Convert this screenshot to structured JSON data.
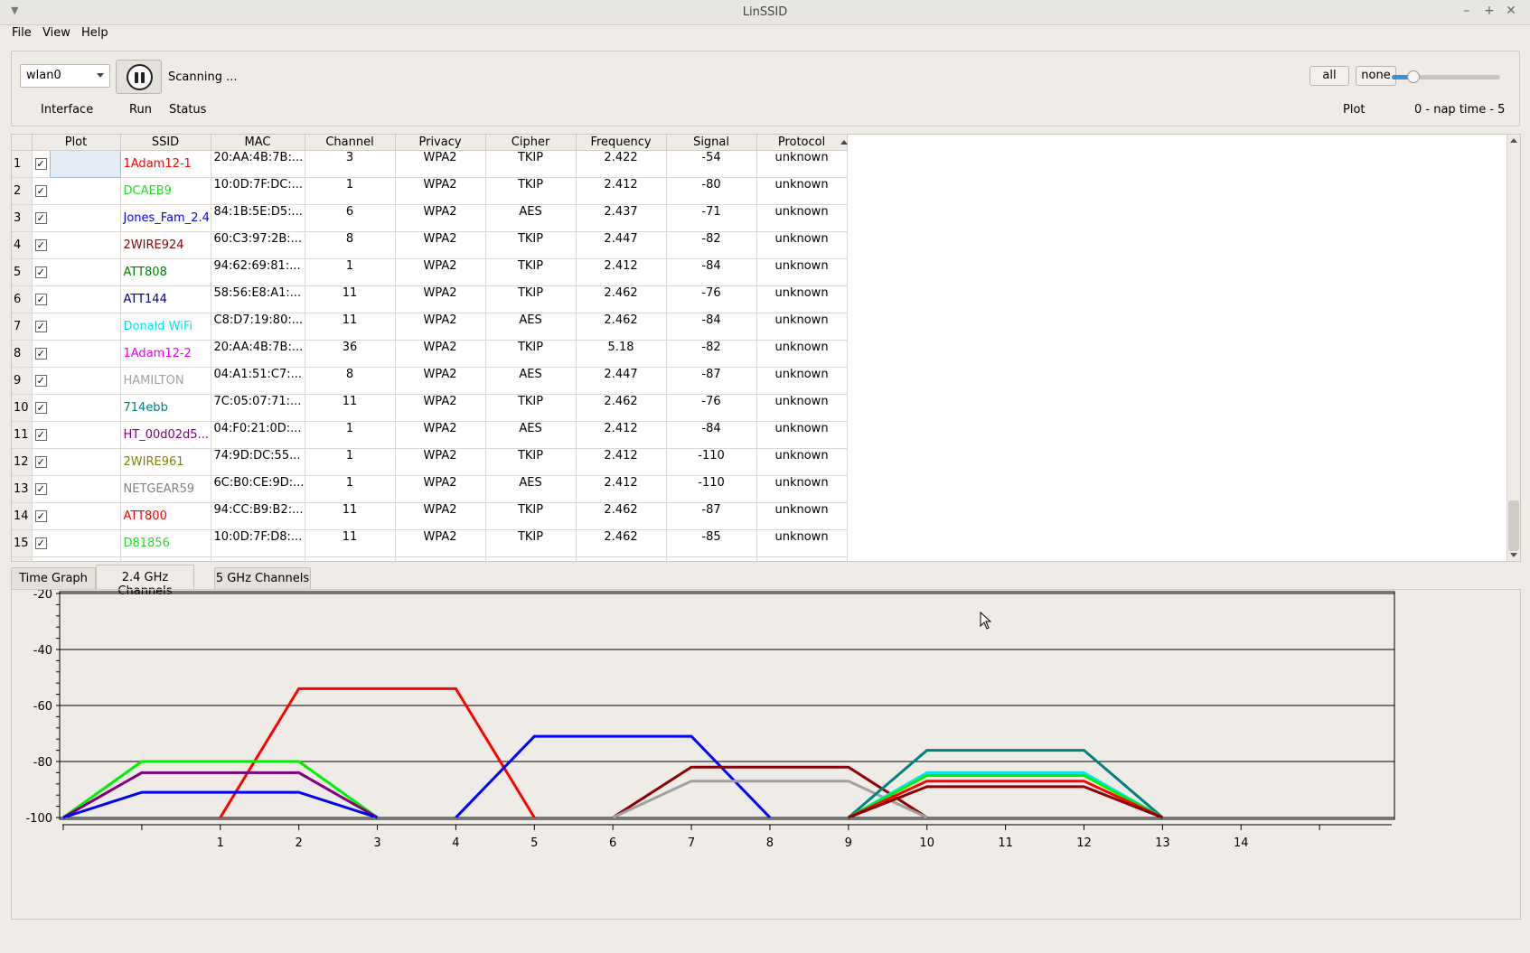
{
  "window": {
    "title": "LinSSID"
  },
  "menu": [
    "File",
    "View",
    "Help"
  ],
  "toolbar": {
    "interface_value": "wlan0",
    "status_text": "Scanning ...",
    "labels": {
      "interface": "Interface",
      "run": "Run",
      "status": "Status",
      "plot": "Plot",
      "naptime": "0 - nap time - 5"
    },
    "all_label": "all",
    "none_label": "none",
    "nap_time": 1
  },
  "table": {
    "columns": [
      "Plot",
      "SSID",
      "MAC",
      "Channel",
      "Privacy",
      "Cipher",
      "Frequency",
      "Signal",
      "Protocol"
    ],
    "rows": [
      {
        "n": "1",
        "ssid": "1Adam12-1",
        "color": "#ff0000",
        "mac": "20:AA:4B:7B:...",
        "channel": "3",
        "privacy": "WPA2",
        "cipher": "TKIP",
        "freq": "2.422",
        "signal": "-54",
        "protocol": "unknown"
      },
      {
        "n": "2",
        "ssid": "DCAEB9",
        "color": "#22dd22",
        "mac": "10:0D:7F:DC:...",
        "channel": "1",
        "privacy": "WPA2",
        "cipher": "TKIP",
        "freq": "2.412",
        "signal": "-80",
        "protocol": "unknown"
      },
      {
        "n": "3",
        "ssid": "Jones_Fam_2.4",
        "color": "#0000ff",
        "mac": "84:1B:5E:D5:...",
        "channel": "6",
        "privacy": "WPA2",
        "cipher": "AES",
        "freq": "2.437",
        "signal": "-71",
        "protocol": "unknown"
      },
      {
        "n": "4",
        "ssid": "2WIRE924",
        "color": "#8b0000",
        "mac": "60:C3:97:2B:...",
        "channel": "8",
        "privacy": "WPA2",
        "cipher": "TKIP",
        "freq": "2.447",
        "signal": "-82",
        "protocol": "unknown"
      },
      {
        "n": "5",
        "ssid": "ATT808",
        "color": "#008000",
        "mac": "94:62:69:81:...",
        "channel": "1",
        "privacy": "WPA2",
        "cipher": "TKIP",
        "freq": "2.412",
        "signal": "-84",
        "protocol": "unknown"
      },
      {
        "n": "6",
        "ssid": "ATT144",
        "color": "#000080",
        "mac": "58:56:E8:A1:...",
        "channel": "11",
        "privacy": "WPA2",
        "cipher": "TKIP",
        "freq": "2.462",
        "signal": "-76",
        "protocol": "unknown"
      },
      {
        "n": "7",
        "ssid": "Donald WiFi",
        "color": "#00e5ee",
        "mac": "C8:D7:19:80:...",
        "channel": "11",
        "privacy": "WPA2",
        "cipher": "AES",
        "freq": "2.462",
        "signal": "-84",
        "protocol": "unknown"
      },
      {
        "n": "8",
        "ssid": "1Adam12-2",
        "color": "#ee00ee",
        "mac": "20:AA:4B:7B:...",
        "channel": "36",
        "privacy": "WPA2",
        "cipher": "TKIP",
        "freq": "5.18",
        "signal": "-82",
        "protocol": "unknown"
      },
      {
        "n": "9",
        "ssid": "HAMILTON",
        "color": "#a0a0a0",
        "mac": "04:A1:51:C7:...",
        "channel": "8",
        "privacy": "WPA2",
        "cipher": "AES",
        "freq": "2.447",
        "signal": "-87",
        "protocol": "unknown"
      },
      {
        "n": "10",
        "ssid": "714ebb",
        "color": "#008080",
        "mac": "7C:05:07:71:...",
        "channel": "11",
        "privacy": "WPA2",
        "cipher": "TKIP",
        "freq": "2.462",
        "signal": "-76",
        "protocol": "unknown"
      },
      {
        "n": "11",
        "ssid": "HT_00d02d5...",
        "color": "#800080",
        "mac": "04:F0:21:0D:...",
        "channel": "1",
        "privacy": "WPA2",
        "cipher": "AES",
        "freq": "2.412",
        "signal": "-84",
        "protocol": "unknown"
      },
      {
        "n": "12",
        "ssid": "2WIRE961",
        "color": "#808000",
        "mac": "74:9D:DC:55...",
        "channel": "1",
        "privacy": "WPA2",
        "cipher": "TKIP",
        "freq": "2.412",
        "signal": "-110",
        "protocol": "unknown"
      },
      {
        "n": "13",
        "ssid": "NETGEAR59",
        "color": "#808080",
        "mac": "6C:B0:CE:9D:...",
        "channel": "1",
        "privacy": "WPA2",
        "cipher": "AES",
        "freq": "2.412",
        "signal": "-110",
        "protocol": "unknown"
      },
      {
        "n": "14",
        "ssid": "ATT800",
        "color": "#ff0000",
        "mac": "94:CC:B9:B2:...",
        "channel": "11",
        "privacy": "WPA2",
        "cipher": "TKIP",
        "freq": "2.462",
        "signal": "-87",
        "protocol": "unknown"
      },
      {
        "n": "15",
        "ssid": "D81856",
        "color": "#22dd22",
        "mac": "10:0D:7F:D8:...",
        "channel": "11",
        "privacy": "WPA2",
        "cipher": "TKIP",
        "freq": "2.462",
        "signal": "-85",
        "protocol": "unknown"
      }
    ]
  },
  "tabs": [
    "Time Graph",
    "2.4 GHz Channels",
    "5 GHz Channels"
  ],
  "active_tab": "2.4 GHz Channels",
  "chart_data": {
    "type": "line",
    "xlim": [
      -1,
      16
    ],
    "ylim": [
      -100,
      -20
    ],
    "yticks": [
      -20,
      -40,
      -60,
      -80,
      -100
    ],
    "xticks": [
      1,
      2,
      3,
      4,
      5,
      6,
      7,
      8,
      9,
      10,
      11,
      12,
      13,
      14
    ],
    "series": [
      {
        "color": "#ff0000",
        "points": [
          [
            1,
            -100
          ],
          [
            2,
            -54
          ],
          [
            4,
            -54
          ],
          [
            5,
            -100
          ]
        ]
      },
      {
        "color": "#0000ff",
        "points": [
          [
            4,
            -100
          ],
          [
            5,
            -71
          ],
          [
            7,
            -71
          ],
          [
            8,
            -100
          ]
        ]
      },
      {
        "color": "#00ee00",
        "points": [
          [
            -1,
            -100
          ],
          [
            0,
            -80
          ],
          [
            2,
            -80
          ],
          [
            3,
            -100
          ]
        ]
      },
      {
        "color": "#800080",
        "points": [
          [
            -1,
            -100
          ],
          [
            0,
            -84
          ],
          [
            2,
            -84
          ],
          [
            3,
            -100
          ]
        ]
      },
      {
        "color": "#0000ff",
        "points": [
          [
            -1,
            -100
          ],
          [
            0,
            -91
          ],
          [
            2,
            -91
          ],
          [
            3,
            -100
          ]
        ]
      },
      {
        "color": "#8b0000",
        "points": [
          [
            6,
            -100
          ],
          [
            7,
            -82
          ],
          [
            9,
            -82
          ],
          [
            10,
            -100
          ]
        ]
      },
      {
        "color": "#a0a0a0",
        "points": [
          [
            6,
            -100
          ],
          [
            7,
            -87
          ],
          [
            9,
            -87
          ],
          [
            10,
            -100
          ]
        ]
      },
      {
        "color": "#008080",
        "points": [
          [
            9,
            -100
          ],
          [
            10,
            -76
          ],
          [
            12,
            -76
          ],
          [
            13,
            -100
          ]
        ]
      },
      {
        "color": "#00e5ee",
        "points": [
          [
            9,
            -100
          ],
          [
            10,
            -84
          ],
          [
            12,
            -84
          ],
          [
            13,
            -100
          ]
        ]
      },
      {
        "color": "#00ee00",
        "points": [
          [
            9,
            -100
          ],
          [
            10,
            -85
          ],
          [
            12,
            -85
          ],
          [
            13,
            -100
          ]
        ]
      },
      {
        "color": "#ff0000",
        "points": [
          [
            9,
            -100
          ],
          [
            10,
            -87
          ],
          [
            12,
            -87
          ],
          [
            13,
            -100
          ]
        ]
      },
      {
        "color": "#8b0000",
        "points": [
          [
            9,
            -100
          ],
          [
            10,
            -89
          ],
          [
            12,
            -89
          ],
          [
            13,
            -100
          ]
        ]
      }
    ]
  }
}
